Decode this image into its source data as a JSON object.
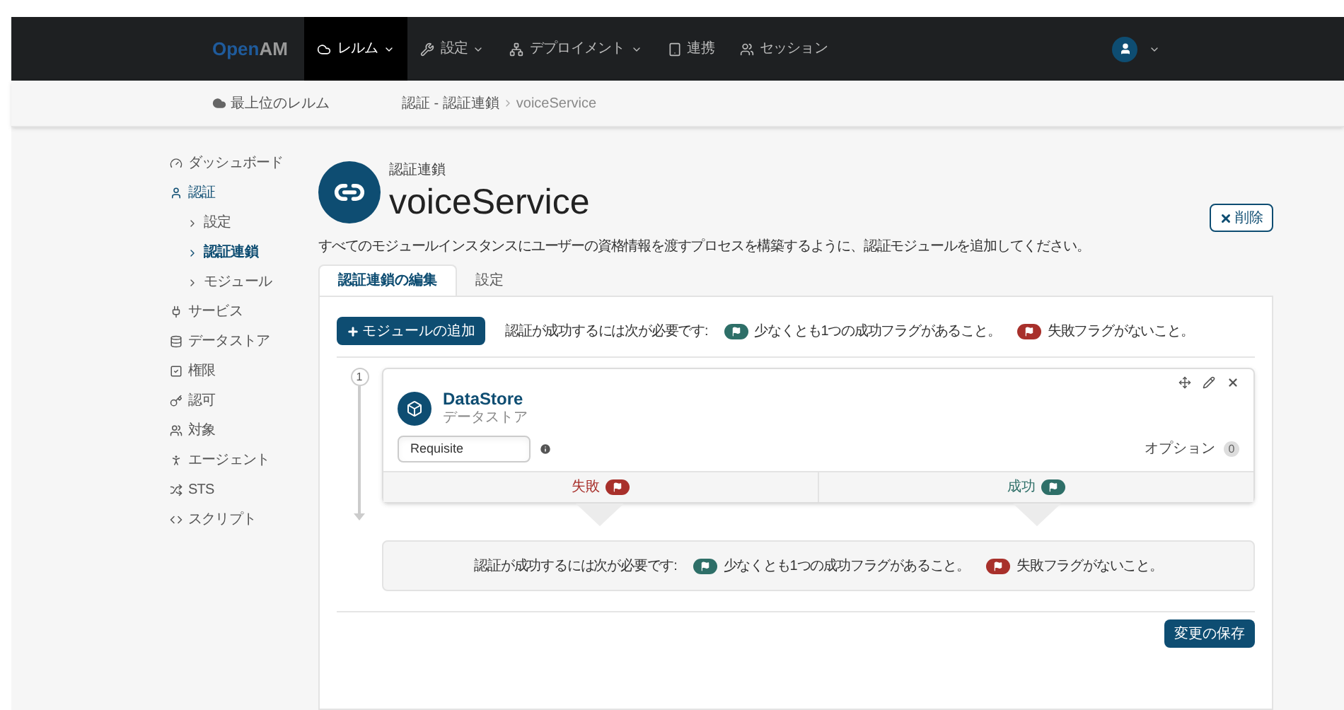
{
  "navbar": {
    "logo_parts": [
      "Open",
      "AM"
    ],
    "items": [
      {
        "label": "レルム",
        "dropdown": true,
        "selected": true
      },
      {
        "label": "設定",
        "dropdown": true,
        "selected": false
      },
      {
        "label": "デプロイメント",
        "dropdown": true,
        "selected": false
      },
      {
        "label": "連携",
        "dropdown": false,
        "selected": false
      },
      {
        "label": "セッション",
        "dropdown": false,
        "selected": false
      }
    ]
  },
  "breadcrumb": {
    "realm": "最上位のレルム",
    "path": "認証 - 認証連鎖",
    "current": "voiceService"
  },
  "sidebar": {
    "items": [
      {
        "label": "ダッシュボード",
        "selected": false
      },
      {
        "label": "認証",
        "selected": true,
        "children": [
          {
            "label": "設定",
            "selected": false
          },
          {
            "label": "認証連鎖",
            "selected": true
          },
          {
            "label": "モジュール",
            "selected": false
          }
        ]
      },
      {
        "label": "サービス",
        "selected": false
      },
      {
        "label": "データストア",
        "selected": false
      },
      {
        "label": "権限",
        "selected": false
      },
      {
        "label": "認可",
        "selected": false
      },
      {
        "label": "対象",
        "selected": false
      },
      {
        "label": "エージェント",
        "selected": false
      },
      {
        "label": "STS",
        "selected": false
      },
      {
        "label": "スクリプト",
        "selected": false
      }
    ]
  },
  "header": {
    "subtitle": "認証連鎖",
    "title": "voiceService",
    "delete_button": "削除"
  },
  "description": "すべてのモジュールインスタンスにユーザーの資格情報を渡すプロセスを構築するように、認証モジュールを追加してください。",
  "tabs": [
    {
      "label": "認証連鎖の編集",
      "selected": true
    },
    {
      "label": "設定",
      "selected": false
    }
  ],
  "add_module_button": "モジュールの追加",
  "requirements_top": {
    "intro": "認証が成功するには次が必要です:",
    "rules": [
      {
        "text": "少なくとも1つの成功フラグがあること。",
        "color": "#2e6f68"
      },
      {
        "text": "失敗フラグがないこと。",
        "color": "#a8302b"
      }
    ]
  },
  "chain": [
    {
      "number": "1",
      "name": "DataStore",
      "type": "データストア",
      "criteria": "Requisite",
      "options_label": "オプション",
      "options_count": "0",
      "outcomes": [
        {
          "label": "失敗",
          "color": "#a8302b"
        },
        {
          "label": "成功",
          "color": "#2e6f68"
        }
      ]
    }
  ],
  "requirements_bottom": {
    "intro": "認証が成功するには次が必要です:",
    "rules": [
      {
        "text": "少なくとも1つの成功フラグがあること。",
        "color": "#2e6f68"
      },
      {
        "text": "失敗フラグがないこと。",
        "color": "#a8302b"
      }
    ]
  },
  "save_button": "変更の保存"
}
